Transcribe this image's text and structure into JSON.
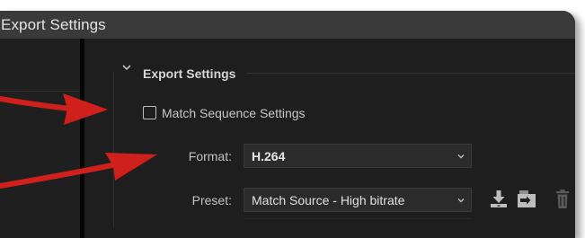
{
  "window": {
    "title": "Export Settings"
  },
  "section": {
    "title": "Export Settings"
  },
  "match_sequence": {
    "label": "Match Sequence Settings",
    "checked": false
  },
  "format": {
    "label": "Format:",
    "value": "H.264"
  },
  "preset": {
    "label": "Preset:",
    "value": "Match Source - High bitrate"
  },
  "icons": {
    "collapse": "chevron-down-icon",
    "dropdown": "dropdown-caret-icon",
    "save_preset": "save-preset-icon",
    "import_preset": "import-preset-icon",
    "delete_preset": "trash-icon",
    "annotation_arrow": "red-arrow-icon"
  },
  "colors": {
    "panel_bg": "#1e1e1e",
    "titlebar_bg": "#3a3a3a",
    "field_bg": "#2b2b2b",
    "annotation_red": "#d0201b"
  }
}
